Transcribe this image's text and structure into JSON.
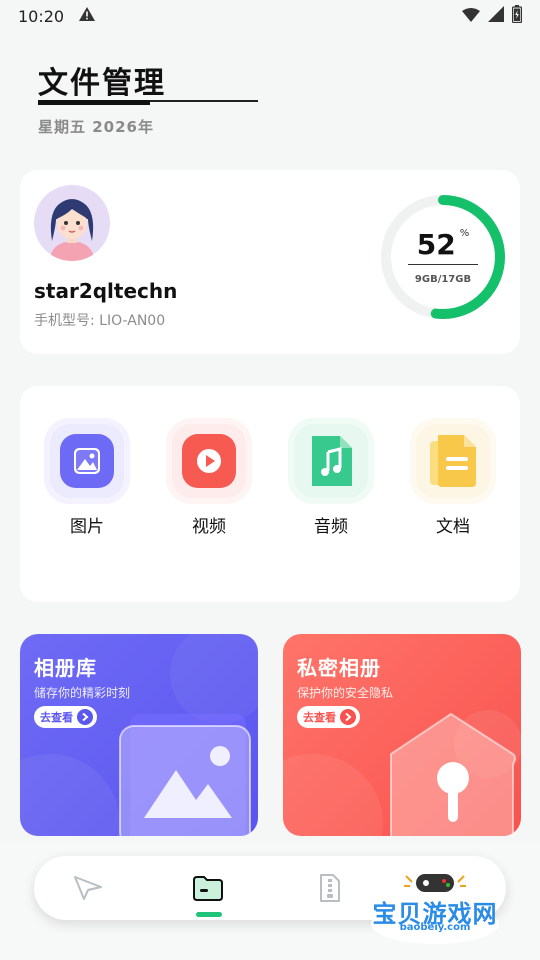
{
  "status_bar": {
    "time": "10:20"
  },
  "header": {
    "title": "文件管理",
    "subtitle": "星期五  2026年"
  },
  "profile": {
    "username": "star2qltechn",
    "device_model": "手机型号: LIO-AN00",
    "storage_percent": "52",
    "storage_percent_sign": "%",
    "storage_used_total": "9GB/17GB",
    "storage_fraction": 0.52,
    "ring_color": "#15c06b"
  },
  "categories": [
    {
      "label": "图片",
      "icon": "image-icon",
      "color": "#6d6af6"
    },
    {
      "label": "视频",
      "icon": "play-icon",
      "color": "#f75a50"
    },
    {
      "label": "音频",
      "icon": "music-icon",
      "color": "#37c98d"
    },
    {
      "label": "文档",
      "icon": "document-icon",
      "color": "#f7c84a"
    }
  ],
  "features": {
    "album": {
      "title": "相册库",
      "desc": "储存你的精彩时刻",
      "button": "去查看"
    },
    "private": {
      "title": "私密相册",
      "desc": "保护你的安全隐私",
      "button": "去查看"
    }
  },
  "nav": {
    "items": [
      "send-icon",
      "folder-icon",
      "zip-icon"
    ],
    "active_color": "#21c27a"
  },
  "watermark": {
    "text": "宝贝游戏网",
    "url": "baobeiy.com"
  }
}
